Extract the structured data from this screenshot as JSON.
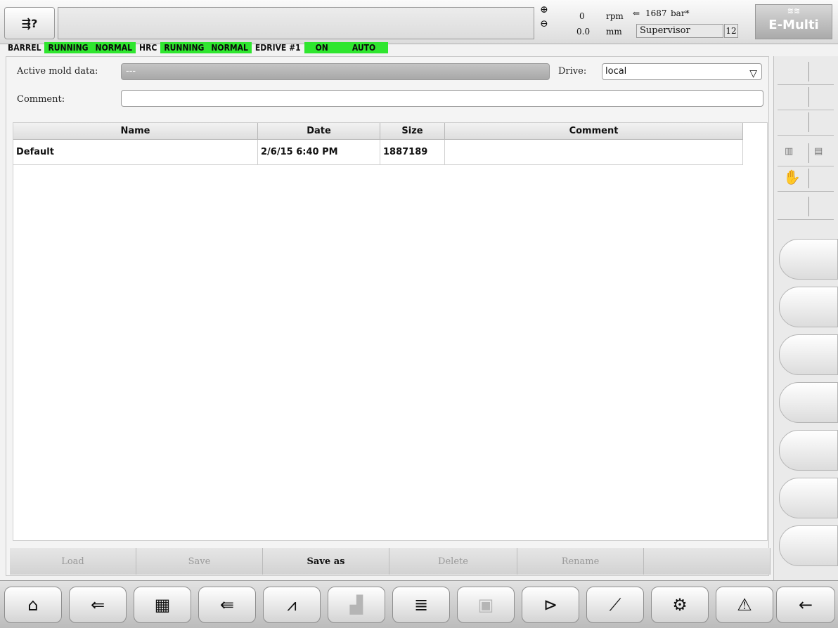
{
  "header": {
    "help_icon": "⇶?",
    "readouts": {
      "screw_speed": "0",
      "screw_speed_unit": "rpm",
      "pressure": "1687",
      "pressure_unit": "bar*",
      "position": "0.0",
      "position_unit": "mm"
    },
    "user": "Supervisor",
    "user_level": "12",
    "logo": "E-Multi"
  },
  "status_strip": [
    {
      "text": "BARREL",
      "on": false
    },
    {
      "text": "RUNNING",
      "on": true
    },
    {
      "text": "NORMAL",
      "on": true
    },
    {
      "text": "HRC",
      "on": false
    },
    {
      "text": "RUNNING",
      "on": true
    },
    {
      "text": "NORMAL",
      "on": true
    },
    {
      "text": "EDRIVE #1",
      "on": false
    },
    {
      "text": "ON",
      "on": true
    },
    {
      "text": "AUTO",
      "on": true
    }
  ],
  "form": {
    "active_mold_label": "Active mold data:",
    "active_mold_value": "---",
    "drive_label": "Drive:",
    "drive_value": "local",
    "comment_label": "Comment:",
    "comment_value": ""
  },
  "table": {
    "columns": [
      "Name",
      "Date",
      "Size",
      "Comment"
    ],
    "rows": [
      {
        "name": "Default",
        "date": "2/6/15 6:40 PM",
        "size": "1887189",
        "comment": ""
      }
    ]
  },
  "actions": {
    "load": "Load",
    "save": "Save",
    "save_as": "Save as",
    "delete": "Delete",
    "rename": "Rename"
  },
  "bottom_nav": [
    "home-icon",
    "injection-unit-icon",
    "barrel-icon",
    "screw-icon",
    "heating-icon",
    "hot-runner-icon",
    "list-icon",
    "mold-icon",
    "ejector-icon",
    "graph-icon",
    "settings-icon",
    "alarm-icon",
    "back-arrow-icon"
  ]
}
